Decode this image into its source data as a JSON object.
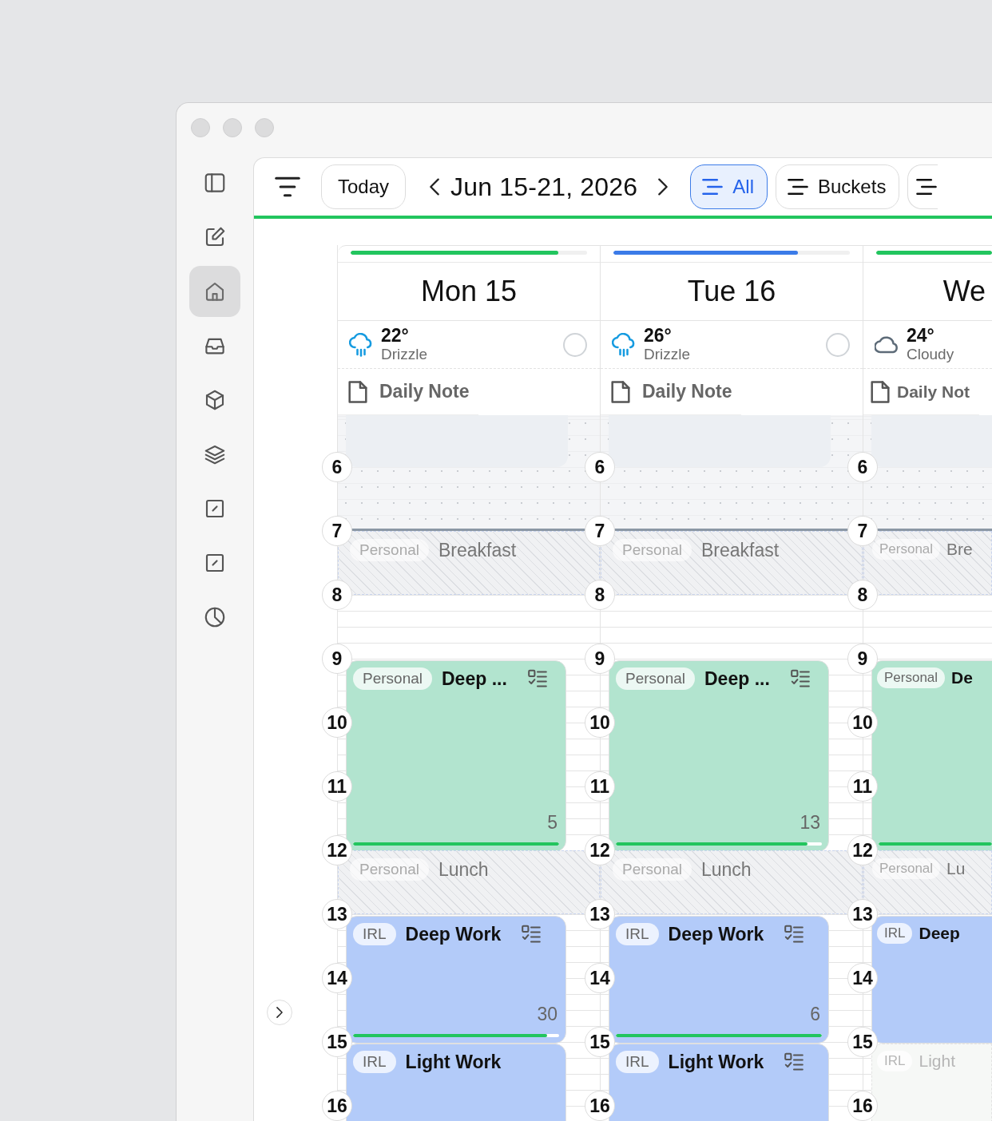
{
  "sidebar": {
    "items": [
      {
        "kind": "panel",
        "selected": false
      },
      {
        "kind": "compose",
        "selected": false
      },
      {
        "kind": "home",
        "selected": true
      },
      {
        "kind": "inbox",
        "selected": false
      },
      {
        "kind": "cube",
        "selected": false
      },
      {
        "kind": "layers",
        "selected": false
      },
      {
        "kind": "slash",
        "selected": false
      },
      {
        "kind": "slash",
        "selected": false
      },
      {
        "kind": "pie",
        "selected": false
      }
    ]
  },
  "toolbar": {
    "today": "Today",
    "range": "Jun 15-21, 2026",
    "views": [
      {
        "label": "All",
        "selected": true
      },
      {
        "label": "Buckets",
        "selected": false
      },
      {
        "selected": false
      }
    ]
  },
  "columns": [
    {
      "day": "Mon 15",
      "bar": {
        "level": 0.88,
        "color": "#22c55e"
      },
      "weather": {
        "kind": "rain",
        "temp": "22°",
        "condition": "Drizzle",
        "done": false
      },
      "note": "Daily Note",
      "ghost_block": true,
      "night_zone": true,
      "hours": [
        {
          "label": "6"
        },
        {
          "label": "7",
          "event": {
            "kind": "blocked",
            "tag": "Personal",
            "title": "Breakfast"
          }
        },
        {
          "label": "8"
        },
        {
          "label": "9",
          "event": {
            "kind": "card",
            "tag": "Personal",
            "title": "Deep ...",
            "color": "#b2e4cf",
            "checklist": true,
            "count": "5",
            "level": 1.0
          }
        },
        {
          "label": "10"
        },
        {
          "label": "11"
        },
        {
          "label": "12",
          "event": {
            "kind": "blocked",
            "tag": "Personal",
            "title": "Lunch"
          }
        },
        {
          "label": "13",
          "event": {
            "kind": "card",
            "tag": "IRL",
            "title": "Deep Work",
            "color": "#b3cbf9",
            "checklist": true,
            "count": "30",
            "level": 0.94
          }
        },
        {
          "label": "14"
        },
        {
          "label": "15",
          "event": {
            "kind": "card",
            "tag": "IRL",
            "title": "Light Work",
            "color": "#b3cbf9",
            "checklist": false
          }
        },
        {
          "label": "16"
        }
      ]
    },
    {
      "day": "Tue 16",
      "bar": {
        "level": 0.78,
        "color": "#3b7be8"
      },
      "weather": {
        "kind": "rain",
        "temp": "26°",
        "condition": "Drizzle",
        "done": false
      },
      "note": "Daily Note",
      "ghost_block": true,
      "night_zone": true,
      "hours": [
        {
          "label": "6"
        },
        {
          "label": "7",
          "event": {
            "kind": "blocked",
            "tag": "Personal",
            "title": "Breakfast"
          }
        },
        {
          "label": "8"
        },
        {
          "label": "9",
          "event": {
            "kind": "card",
            "tag": "Personal",
            "title": "Deep ...",
            "color": "#b2e4cf",
            "checklist": true,
            "count": "13",
            "level": 0.93
          }
        },
        {
          "label": "10"
        },
        {
          "label": "11"
        },
        {
          "label": "12",
          "event": {
            "kind": "blocked",
            "tag": "Personal",
            "title": "Lunch"
          }
        },
        {
          "label": "13",
          "event": {
            "kind": "card",
            "tag": "IRL",
            "title": "Deep Work",
            "color": "#b3cbf9",
            "checklist": true,
            "count": "6",
            "level": 1.0
          }
        },
        {
          "label": "14"
        },
        {
          "label": "15",
          "event": {
            "kind": "card",
            "tag": "IRL",
            "title": "Light Work",
            "color": "#b3cbf9",
            "checklist": true
          }
        },
        {
          "label": "16"
        }
      ]
    },
    {
      "day": "We",
      "bar": {
        "level": 1.0,
        "color": "#22c55e"
      },
      "weather": {
        "kind": "cloud",
        "temp": "24°",
        "condition": "Cloudy"
      },
      "note": "Daily Not",
      "ghost_block": true,
      "night_zone": true,
      "hours": [
        {
          "label": "6"
        },
        {
          "label": "7",
          "event": {
            "kind": "blocked",
            "tag": "Personal",
            "title": "Bre"
          }
        },
        {
          "label": "8"
        },
        {
          "label": "9",
          "event": {
            "kind": "card",
            "tag": "Personal",
            "title": "De",
            "color": "#b2e4cf",
            "level": 1.0
          }
        },
        {
          "label": "10"
        },
        {
          "label": "11"
        },
        {
          "label": "12",
          "event": {
            "kind": "blocked",
            "tag": "Personal",
            "title": "Lu"
          }
        },
        {
          "label": "13",
          "event": {
            "kind": "card",
            "tag": "IRL",
            "title": "Deep",
            "color": "#b3cbf9"
          }
        },
        {
          "label": "14"
        },
        {
          "label": "15",
          "event": {
            "kind": "card",
            "tag": "IRL",
            "title": "Light",
            "faded": true
          }
        },
        {
          "label": "16"
        }
      ]
    }
  ]
}
